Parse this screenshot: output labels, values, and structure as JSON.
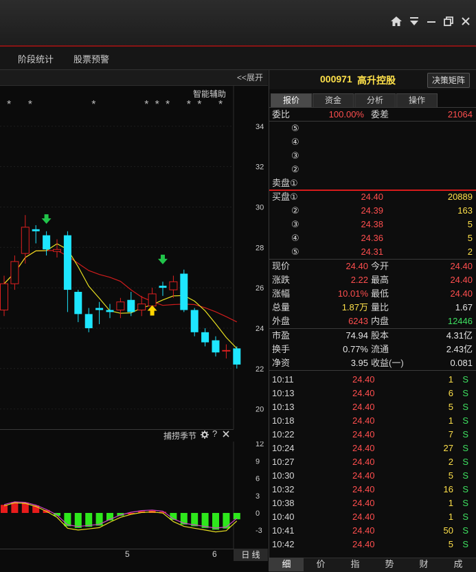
{
  "window": {
    "home_icon": "home-icon",
    "dropdown_icon": "chevron-down-icon",
    "minimize_icon": "minimize-icon",
    "restore_icon": "restore-icon",
    "close_icon": "close-icon"
  },
  "menu": {
    "items": [
      {
        "label": "阶段统计"
      },
      {
        "label": "股票预警"
      }
    ]
  },
  "chart": {
    "expand_label": "<<展开",
    "assist_label": "智能辅助",
    "indicator_title": "捕捞季节",
    "price_ticks": [
      "34",
      "32",
      "30",
      "28",
      "26",
      "24",
      "22",
      "20"
    ],
    "indicator_ticks": [
      "12",
      "9",
      "6",
      "3",
      "0",
      "-3"
    ],
    "time_labels": [
      "5",
      "6"
    ],
    "period_label": "日 线",
    "colors": {
      "up": "#e02020",
      "down": "#1ee6ff",
      "ma1": "#e8e020",
      "ma2": "#d01c1c",
      "signal_sell": "#21c44a",
      "signal_buy": "#ffd400"
    }
  },
  "chart_data": {
    "type": "candlestick",
    "ylim": [
      19,
      36
    ],
    "candles": [
      {
        "o": 24.9,
        "c": 26.2,
        "h": 26.6,
        "l": 24.6
      },
      {
        "o": 26.2,
        "c": 27.3,
        "h": 27.6,
        "l": 25.9
      },
      {
        "o": 27.7,
        "c": 29.0,
        "h": 29.6,
        "l": 27.2
      },
      {
        "o": 28.9,
        "c": 28.8,
        "h": 29.1,
        "l": 28.2
      },
      {
        "o": 28.6,
        "c": 27.9,
        "h": 28.8,
        "l": 27.6
      },
      {
        "o": 27.8,
        "c": 27.9,
        "h": 28.4,
        "l": 27.5
      },
      {
        "o": 28.6,
        "c": 25.9,
        "h": 28.8,
        "l": 24.8
      },
      {
        "o": 25.8,
        "c": 24.7,
        "h": 25.9,
        "l": 24.3
      },
      {
        "o": 24.7,
        "c": 24.0,
        "h": 25.0,
        "l": 23.8
      },
      {
        "o": 25.0,
        "c": 24.9,
        "h": 25.3,
        "l": 24.2
      },
      {
        "o": 24.9,
        "c": 24.8,
        "h": 25.2,
        "l": 24.5
      },
      {
        "o": 24.9,
        "c": 25.3,
        "h": 25.5,
        "l": 24.5
      },
      {
        "o": 25.4,
        "c": 24.8,
        "h": 25.8,
        "l": 24.6
      },
      {
        "o": 24.9,
        "c": 25.2,
        "h": 25.6,
        "l": 24.6
      },
      {
        "o": 25.1,
        "c": 25.7,
        "h": 26.0,
        "l": 24.9
      },
      {
        "o": 26.1,
        "c": 26.0,
        "h": 26.3,
        "l": 25.6
      },
      {
        "o": 25.9,
        "c": 26.3,
        "h": 26.6,
        "l": 25.5
      },
      {
        "o": 26.7,
        "c": 24.9,
        "h": 26.9,
        "l": 24.8
      },
      {
        "o": 24.9,
        "c": 23.8,
        "h": 25.0,
        "l": 23.6
      },
      {
        "o": 23.8,
        "c": 23.3,
        "h": 24.0,
        "l": 23.1
      },
      {
        "o": 23.4,
        "c": 22.8,
        "h": 23.6,
        "l": 22.6
      },
      {
        "o": 22.9,
        "c": 22.9,
        "h": 23.2,
        "l": 22.5
      },
      {
        "o": 23.0,
        "c": 22.2,
        "h": 23.1,
        "l": 22.0
      }
    ]
  },
  "quote": {
    "code": "000971",
    "name": "高升控股",
    "decision_button": "决策矩阵",
    "tabs": [
      {
        "label": "报价"
      },
      {
        "label": "资金"
      },
      {
        "label": "分析"
      },
      {
        "label": "操作"
      }
    ],
    "weibi_label": "委比",
    "weibi_value": "100.00%",
    "weicha_label": "委差",
    "weicha_value": "21064",
    "sell_label": "卖盘①",
    "sell_markers": [
      "⑤",
      "④",
      "③",
      "②"
    ],
    "buy_label": "买盘①",
    "bids": [
      {
        "level": "",
        "price": "24.40",
        "vol": "20889"
      },
      {
        "level": "②",
        "price": "24.39",
        "vol": "163"
      },
      {
        "level": "③",
        "price": "24.38",
        "vol": "5"
      },
      {
        "level": "④",
        "price": "24.36",
        "vol": "5"
      },
      {
        "level": "⑤",
        "price": "24.31",
        "vol": "2"
      }
    ],
    "stats": [
      {
        "l1": "现价",
        "v1": "24.40",
        "c1": "red",
        "l2": "今开",
        "v2": "24.40",
        "c2": "red"
      },
      {
        "l1": "涨跌",
        "v1": "2.22",
        "c1": "red",
        "l2": "最高",
        "v2": "24.40",
        "c2": "red"
      },
      {
        "l1": "涨幅",
        "v1": "10.01%",
        "c1": "red",
        "l2": "最低",
        "v2": "24.40",
        "c2": "red"
      },
      {
        "l1": "总量",
        "v1": "1.87万",
        "c1": "yel",
        "l2": "量比",
        "v2": "1.67",
        "c2": "wht"
      },
      {
        "l1": "外盘",
        "v1": "6243",
        "c1": "red",
        "l2": "内盘",
        "v2": "12446",
        "c2": "grn"
      }
    ],
    "fundamentals": [
      {
        "l1": "市盈",
        "v1": "74.94",
        "l2": "股本",
        "v2": "4.31亿"
      },
      {
        "l1": "换手",
        "v1": "0.77%",
        "l2": "流通",
        "v2": "2.43亿"
      },
      {
        "l1": "净资",
        "v1": "3.95",
        "l2": "收益(一)",
        "v2": "0.081"
      }
    ],
    "ticks": [
      {
        "t": "10:11",
        "p": "24.40",
        "v": "1",
        "s": "S"
      },
      {
        "t": "10:13",
        "p": "24.40",
        "v": "6",
        "s": "S"
      },
      {
        "t": "10:13",
        "p": "24.40",
        "v": "5",
        "s": "S"
      },
      {
        "t": "10:18",
        "p": "24.40",
        "v": "1",
        "s": "S"
      },
      {
        "t": "10:22",
        "p": "24.40",
        "v": "7",
        "s": "S"
      },
      {
        "t": "10:24",
        "p": "24.40",
        "v": "27",
        "s": "S"
      },
      {
        "t": "10:27",
        "p": "24.40",
        "v": "2",
        "s": "S"
      },
      {
        "t": "10:30",
        "p": "24.40",
        "v": "5",
        "s": "S"
      },
      {
        "t": "10:32",
        "p": "24.40",
        "v": "16",
        "s": "S"
      },
      {
        "t": "10:38",
        "p": "24.40",
        "v": "1",
        "s": "S"
      },
      {
        "t": "10:40",
        "p": "24.40",
        "v": "1",
        "s": "S"
      },
      {
        "t": "10:41",
        "p": "24.40",
        "v": "50",
        "s": "S"
      },
      {
        "t": "10:42",
        "p": "24.40",
        "v": "5",
        "s": "S"
      }
    ],
    "bottom_tabs": [
      {
        "label": "细"
      },
      {
        "label": "价"
      },
      {
        "label": "指"
      },
      {
        "label": "势"
      },
      {
        "label": "财"
      },
      {
        "label": "成"
      }
    ]
  }
}
